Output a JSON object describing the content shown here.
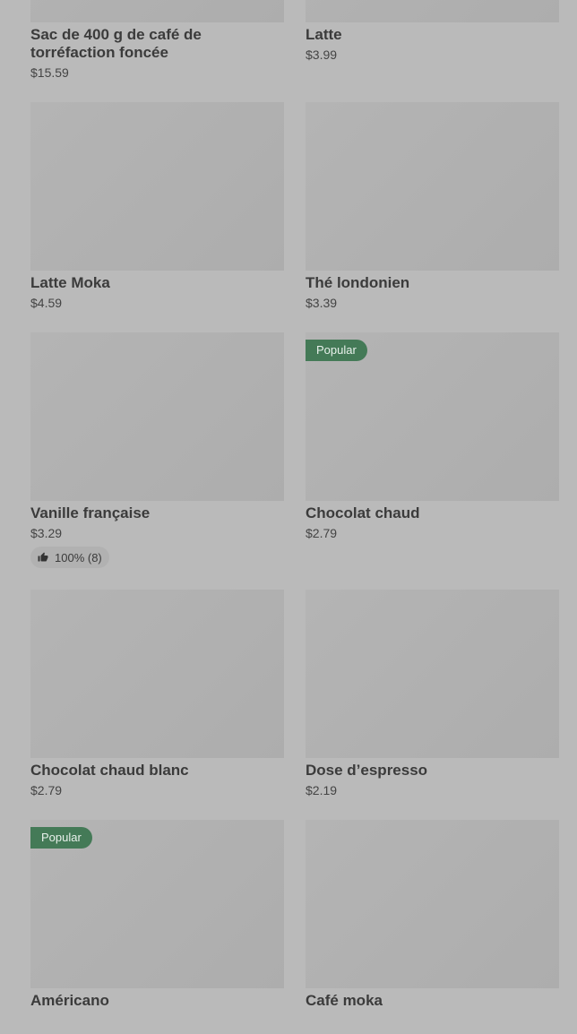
{
  "products": [
    {
      "name": "Sac de 400 g de café de torréfaction foncée",
      "price": "$15.59"
    },
    {
      "name": "Latte",
      "price": "$3.99"
    },
    {
      "name": "Latte Moka",
      "price": "$4.59"
    },
    {
      "name": "Thé londonien",
      "price": "$3.39"
    },
    {
      "name": "Vanille française",
      "price": "$3.29",
      "rating": "100% (8)"
    },
    {
      "name": "Chocolat chaud",
      "price": "$2.79",
      "badge": "Popular"
    },
    {
      "name": "Chocolat chaud blanc",
      "price": "$2.79"
    },
    {
      "name": "Dose d’espresso",
      "price": "$2.19"
    },
    {
      "name": "Américano",
      "price": "",
      "badge": "Popular"
    },
    {
      "name": "Café moka",
      "price": ""
    }
  ],
  "icons": {
    "rating": "thumbs-up-icon"
  },
  "colors": {
    "badge_bg": "#447a57",
    "page_bg": "#bababa"
  }
}
